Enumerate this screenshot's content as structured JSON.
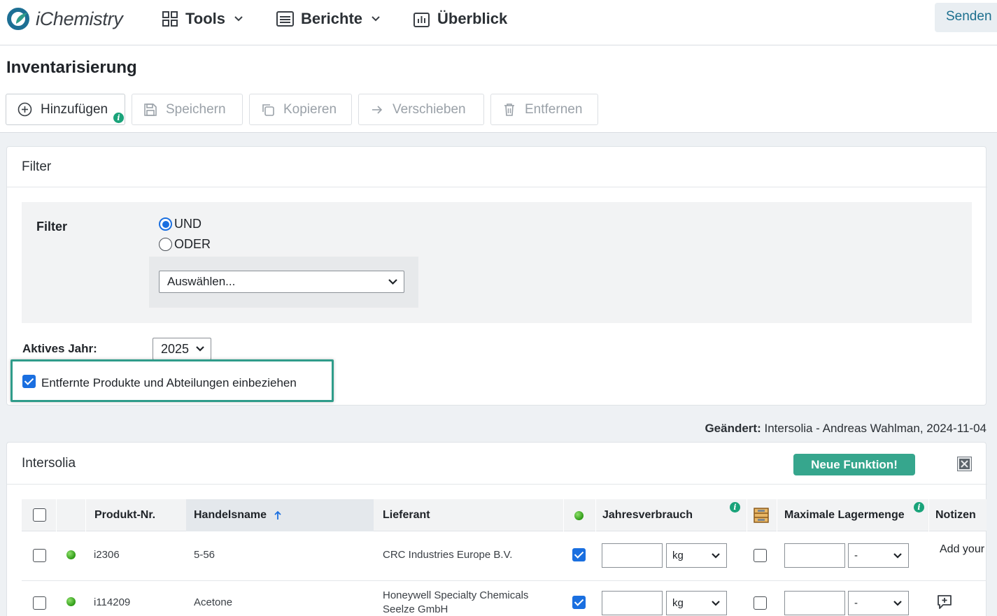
{
  "app": {
    "name": "iChemistry"
  },
  "nav": {
    "tools": "Tools",
    "reports": "Berichte",
    "overview": "Überblick",
    "send": "Senden"
  },
  "page": {
    "title": "Inventarisierung"
  },
  "toolbar": {
    "add": "Hinzufügen",
    "save": "Speichern",
    "copy": "Kopieren",
    "move": "Verschieben",
    "remove": "Entfernen"
  },
  "filter": {
    "card_title": "Filter",
    "label": "Filter",
    "and": "UND",
    "or": "ODER",
    "logic_selected": "UND",
    "select_placeholder": "Auswählen...",
    "active_year_label": "Aktives Jahr:",
    "active_year": "2025",
    "include_removed_label": "Entfernte Produkte und Abteilungen einbeziehen",
    "include_removed": true
  },
  "changed": {
    "label": "Geändert:",
    "value": "Intersolia - Andreas Wahlman, 2024-11-04"
  },
  "table": {
    "card_title": "Intersolia",
    "new_feature": "Neue Funktion!",
    "columns": {
      "product_no": "Produkt-Nr.",
      "trade_name": "Handelsname",
      "supplier": "Lieferant",
      "annual_use": "Jahresverbrauch",
      "max_storage": "Maximale Lagermenge",
      "notes": "Notizen"
    },
    "rows": [
      {
        "product_no": "i2306",
        "trade_name": "5-56",
        "supplier_line1": "CRC Industries Europe B.V.",
        "supplier_line2": "",
        "active": true,
        "unit": "kg",
        "storage_unit": "-",
        "note": "Add your"
      },
      {
        "product_no": "i114209",
        "trade_name": "Acetone",
        "supplier_line1": "Honeywell Specialty Chemicals",
        "supplier_line2": "Seelze GmbH",
        "active": true,
        "unit": "kg",
        "storage_unit": "-",
        "note": ""
      }
    ]
  },
  "colors": {
    "accent": "#36a68d",
    "highlight": "#2f9c8a",
    "checkbox": "#1a6fe0",
    "status_green": "#2e9a16"
  }
}
